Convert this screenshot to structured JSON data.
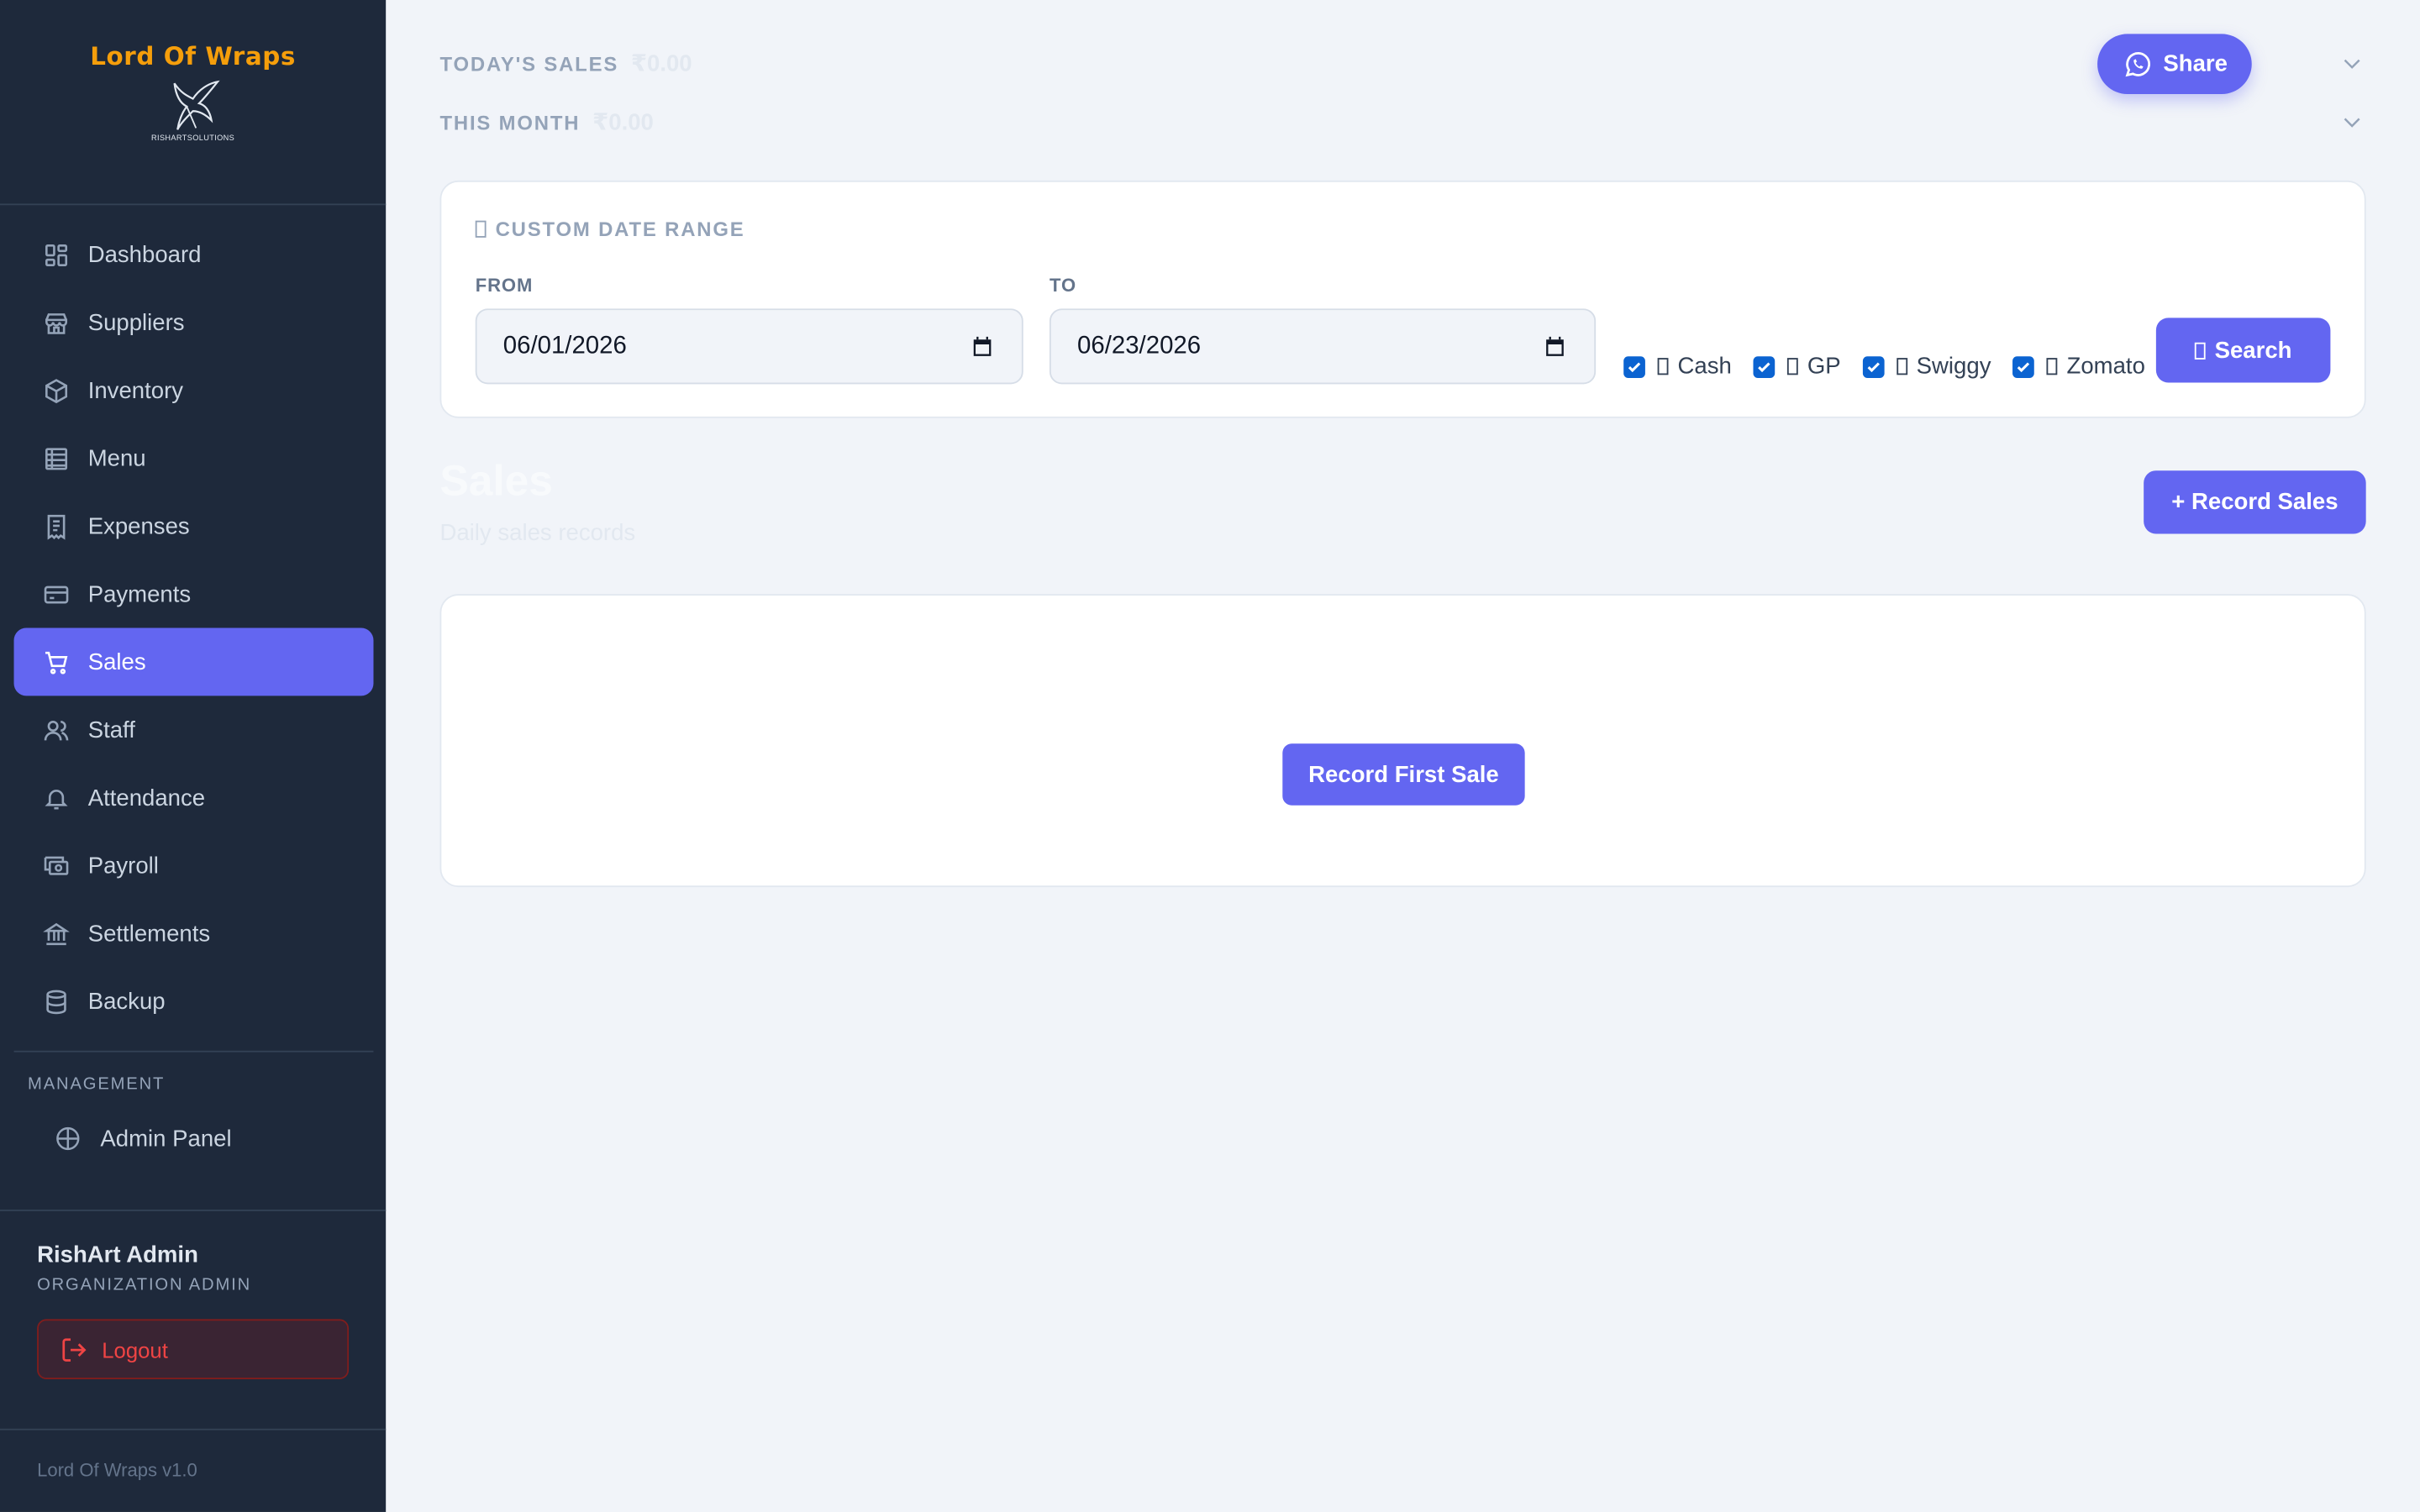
{
  "app": {
    "brand": "Lord Of Wraps",
    "brand_sub": "RISHARTSOLUTIONS",
    "version": "Lord Of Wraps v1.0"
  },
  "sidebar": {
    "items": [
      {
        "label": "Dashboard",
        "icon": "dashboard-icon"
      },
      {
        "label": "Suppliers",
        "icon": "store-icon"
      },
      {
        "label": "Inventory",
        "icon": "box-icon"
      },
      {
        "label": "Menu",
        "icon": "menu-icon"
      },
      {
        "label": "Expenses",
        "icon": "receipt-icon"
      },
      {
        "label": "Payments",
        "icon": "card-icon"
      },
      {
        "label": "Sales",
        "icon": "cart-icon",
        "active": true
      },
      {
        "label": "Staff",
        "icon": "users-icon"
      },
      {
        "label": "Attendance",
        "icon": "bell-icon"
      },
      {
        "label": "Payroll",
        "icon": "payroll-icon"
      },
      {
        "label": "Settlements",
        "icon": "bank-icon"
      },
      {
        "label": "Backup",
        "icon": "database-icon"
      }
    ],
    "management_label": "MANAGEMENT",
    "admin_panel": "Admin Panel"
  },
  "user": {
    "name": "RishArt Admin",
    "role": "ORGANIZATION ADMIN",
    "logout": "Logout"
  },
  "stats": {
    "today_label": "TODAY'S SALES",
    "today_value": "₹0.00",
    "month_label": "THIS MONTH",
    "month_value": "₹0.00"
  },
  "share": {
    "label": "Share"
  },
  "range": {
    "title": "CUSTOM DATE RANGE",
    "from_label": "FROM",
    "from_value": "06/01/2026",
    "to_label": "TO",
    "to_value": "06/23/2026",
    "filters": [
      {
        "label": "Cash",
        "checked": true
      },
      {
        "label": "GP",
        "checked": true
      },
      {
        "label": "Swiggy",
        "checked": true
      },
      {
        "label": "Zomato",
        "checked": true
      }
    ],
    "search": "Search"
  },
  "page": {
    "title": "Sales",
    "subtitle": "Daily sales records",
    "record_button": "+ Record Sales"
  },
  "empty": {
    "button": "Record First Sale"
  },
  "colors": {
    "accent": "#6366f1",
    "sidebar": "#1e293b",
    "brand": "#f59e0b",
    "danger": "#ef4444"
  }
}
